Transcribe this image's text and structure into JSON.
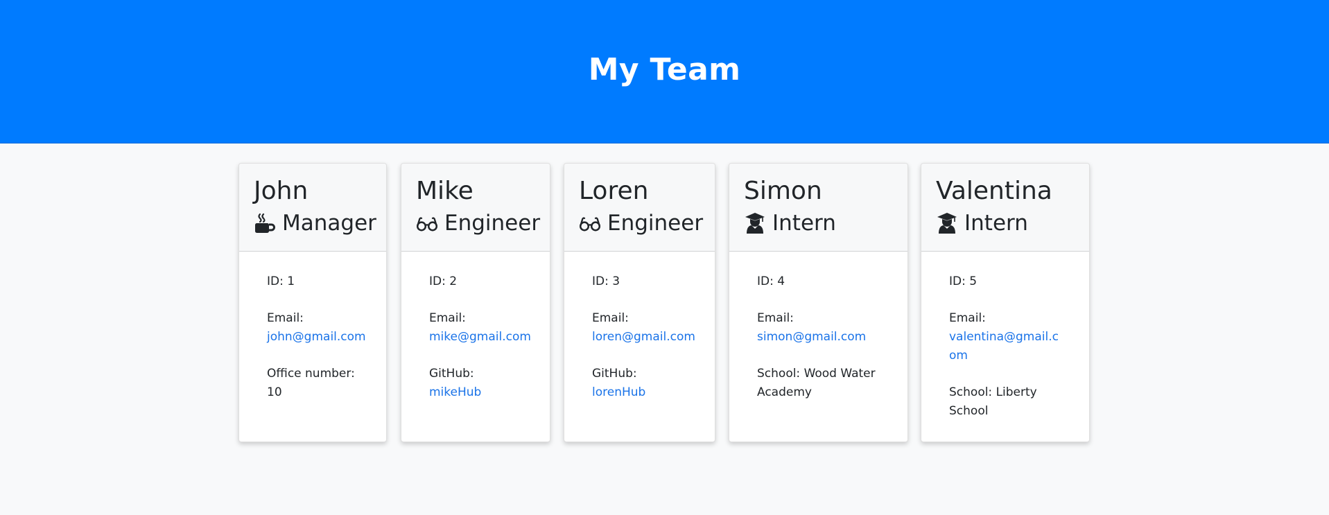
{
  "header": {
    "title": "My Team"
  },
  "cards": [
    {
      "name": "John",
      "role": "Manager",
      "icon": "coffee-icon",
      "id_label": "ID: 1",
      "email_label": "Email:",
      "email": "john@gmail.com",
      "extra_label": "Office number:",
      "extra_value": "10"
    },
    {
      "name": "Mike",
      "role": "Engineer",
      "icon": "glasses-icon",
      "id_label": "ID: 2",
      "email_label": "Email:",
      "email": "mike@gmail.com",
      "extra_label": "GitHub:",
      "extra_value": "mikeHub"
    },
    {
      "name": "Loren",
      "role": "Engineer",
      "icon": "glasses-icon",
      "id_label": "ID: 3",
      "email_label": "Email:",
      "email": "loren@gmail.com",
      "extra_label": "GitHub:",
      "extra_value": "lorenHub"
    },
    {
      "name": "Simon",
      "role": "Intern",
      "icon": "graduate-icon",
      "id_label": "ID: 4",
      "email_label": "Email:",
      "email": "simon@gmail.com",
      "extra_text": "School: Wood Water Academy"
    },
    {
      "name": "Valentina",
      "role": "Intern",
      "icon": "graduate-icon",
      "id_label": "ID: 5",
      "email_label": "Email:",
      "email": "valentina@gmail.com",
      "extra_text": "School: Liberty School"
    }
  ],
  "colors": {
    "header_bg": "#007bff",
    "link": "#1a73e8",
    "page_bg": "#f8f9fa"
  }
}
